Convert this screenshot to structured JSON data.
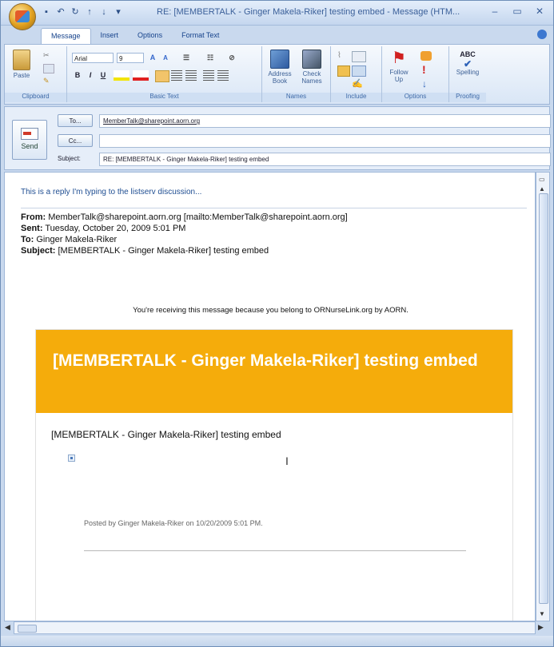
{
  "window": {
    "title": "RE: [MEMBERTALK - Ginger Makela-Riker] testing embed - Message (HTM...",
    "controls": [
      "–",
      "▭",
      "✕"
    ]
  },
  "ribbon_tabs": [
    "Message",
    "Insert",
    "Options",
    "Format Text"
  ],
  "ribbon": {
    "clipboard": {
      "paste": "Paste",
      "label": "Clipboard"
    },
    "basic_text": {
      "font": "Arial",
      "size": "9",
      "bold": "B",
      "italic": "I",
      "underline": "U",
      "label": "Basic Text"
    },
    "names": {
      "address_book": "Address Book",
      "check_names": "Check Names",
      "label": "Names"
    },
    "include": {
      "label": "Include"
    },
    "options": {
      "follow_up": "Follow Up",
      "label": "Options"
    },
    "proofing": {
      "spelling": "Spelling",
      "abc": "ABC",
      "label": "Proofing"
    }
  },
  "header": {
    "send": "Send",
    "to_button": "To...",
    "cc_button": "Cc...",
    "subject_label": "Subject:",
    "to_value": "MemberTalk@sharepoint.aorn.org",
    "cc_value": "",
    "subject_value": "RE: [MEMBERTALK - Ginger Makela-Riker] testing embed"
  },
  "body": {
    "reply_text": "This is a reply I'm typing to the listserv discussion...",
    "from_label": "From:",
    "from_value": "MemberTalk@sharepoint.aorn.org [mailto:MemberTalk@sharepoint.aorn.org]",
    "sent_label": "Sent:",
    "sent_value": "Tuesday, October 20, 2009 5:01 PM",
    "to_label": "To:",
    "to_value": "Ginger Makela-Riker",
    "subject_label": "Subject:",
    "subject_value": "[MEMBERTALK - Ginger Makela-Riker] testing embed",
    "notice": "You're receiving this message because you belong to ORNurseLink.org by AORN.",
    "banner_title": "[MEMBERTALK - Ginger Makela-Riker] testing embed",
    "card_subject": "[MEMBERTALK - Ginger Makela-Riker] testing embed",
    "posted": "Posted by Ginger Makela-Riker on 10/20/2009 5:01 PM."
  },
  "colors": {
    "banner": "#f5ac0b",
    "reply_text": "#1f4e92",
    "ribbon_accent": "#15428b"
  }
}
